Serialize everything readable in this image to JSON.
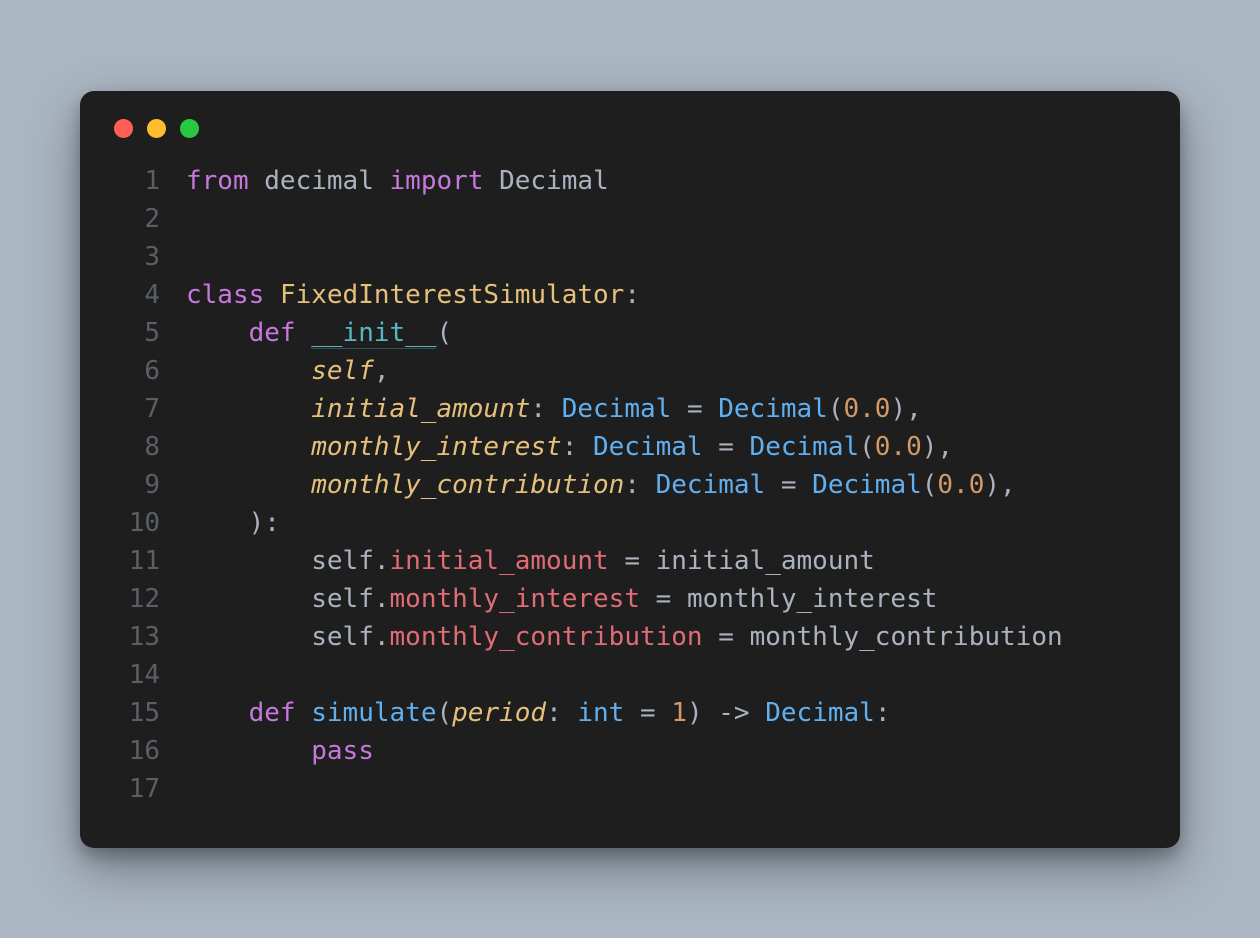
{
  "window": {
    "traffic_lights": [
      "red",
      "yellow",
      "green"
    ]
  },
  "code": {
    "lines": [
      {
        "n": "1",
        "tokens": [
          {
            "cls": "tok-keyword",
            "t": "from"
          },
          {
            "cls": "tok-punct",
            "t": " "
          },
          {
            "cls": "tok-module",
            "t": "decimal"
          },
          {
            "cls": "tok-punct",
            "t": " "
          },
          {
            "cls": "tok-keyword",
            "t": "import"
          },
          {
            "cls": "tok-punct",
            "t": " "
          },
          {
            "cls": "tok-module",
            "t": "Decimal"
          }
        ]
      },
      {
        "n": "2",
        "tokens": []
      },
      {
        "n": "3",
        "tokens": []
      },
      {
        "n": "4",
        "tokens": [
          {
            "cls": "tok-keyword",
            "t": "class"
          },
          {
            "cls": "tok-punct",
            "t": " "
          },
          {
            "cls": "tok-class",
            "t": "FixedInterestSimulator"
          },
          {
            "cls": "tok-punct",
            "t": ":"
          }
        ]
      },
      {
        "n": "5",
        "tokens": [
          {
            "cls": "tok-punct",
            "t": "    "
          },
          {
            "cls": "tok-keyword",
            "t": "def"
          },
          {
            "cls": "tok-punct",
            "t": " "
          },
          {
            "cls": "tok-dunder",
            "t": "__init__"
          },
          {
            "cls": "tok-punct",
            "t": "("
          }
        ]
      },
      {
        "n": "6",
        "tokens": [
          {
            "cls": "tok-punct",
            "t": "        "
          },
          {
            "cls": "tok-self",
            "t": "self"
          },
          {
            "cls": "tok-punct",
            "t": ","
          }
        ]
      },
      {
        "n": "7",
        "tokens": [
          {
            "cls": "tok-punct",
            "t": "        "
          },
          {
            "cls": "tok-param",
            "t": "initial_amount"
          },
          {
            "cls": "tok-punct",
            "t": ": "
          },
          {
            "cls": "tok-type",
            "t": "Decimal"
          },
          {
            "cls": "tok-punct",
            "t": " "
          },
          {
            "cls": "tok-op",
            "t": "="
          },
          {
            "cls": "tok-punct",
            "t": " "
          },
          {
            "cls": "tok-call",
            "t": "Decimal"
          },
          {
            "cls": "tok-punct",
            "t": "("
          },
          {
            "cls": "tok-num",
            "t": "0.0"
          },
          {
            "cls": "tok-punct",
            "t": "),"
          }
        ]
      },
      {
        "n": "8",
        "tokens": [
          {
            "cls": "tok-punct",
            "t": "        "
          },
          {
            "cls": "tok-param",
            "t": "monthly_interest"
          },
          {
            "cls": "tok-punct",
            "t": ": "
          },
          {
            "cls": "tok-type",
            "t": "Decimal"
          },
          {
            "cls": "tok-punct",
            "t": " "
          },
          {
            "cls": "tok-op",
            "t": "="
          },
          {
            "cls": "tok-punct",
            "t": " "
          },
          {
            "cls": "tok-call",
            "t": "Decimal"
          },
          {
            "cls": "tok-punct",
            "t": "("
          },
          {
            "cls": "tok-num",
            "t": "0.0"
          },
          {
            "cls": "tok-punct",
            "t": "),"
          }
        ]
      },
      {
        "n": "9",
        "tokens": [
          {
            "cls": "tok-punct",
            "t": "        "
          },
          {
            "cls": "tok-param",
            "t": "monthly_contribution"
          },
          {
            "cls": "tok-punct",
            "t": ": "
          },
          {
            "cls": "tok-type",
            "t": "Decimal"
          },
          {
            "cls": "tok-punct",
            "t": " "
          },
          {
            "cls": "tok-op",
            "t": "="
          },
          {
            "cls": "tok-punct",
            "t": " "
          },
          {
            "cls": "tok-call",
            "t": "Decimal"
          },
          {
            "cls": "tok-punct",
            "t": "("
          },
          {
            "cls": "tok-num",
            "t": "0.0"
          },
          {
            "cls": "tok-punct",
            "t": "),"
          }
        ]
      },
      {
        "n": "10",
        "tokens": [
          {
            "cls": "tok-punct",
            "t": "    ):"
          }
        ]
      },
      {
        "n": "11",
        "tokens": [
          {
            "cls": "tok-punct",
            "t": "        "
          },
          {
            "cls": "tok-ident",
            "t": "self"
          },
          {
            "cls": "tok-punct",
            "t": "."
          },
          {
            "cls": "tok-attr",
            "t": "initial_amount"
          },
          {
            "cls": "tok-punct",
            "t": " "
          },
          {
            "cls": "tok-op",
            "t": "="
          },
          {
            "cls": "tok-punct",
            "t": " "
          },
          {
            "cls": "tok-ident",
            "t": "initial_amount"
          }
        ]
      },
      {
        "n": "12",
        "tokens": [
          {
            "cls": "tok-punct",
            "t": "        "
          },
          {
            "cls": "tok-ident",
            "t": "self"
          },
          {
            "cls": "tok-punct",
            "t": "."
          },
          {
            "cls": "tok-attr",
            "t": "monthly_interest"
          },
          {
            "cls": "tok-punct",
            "t": " "
          },
          {
            "cls": "tok-op",
            "t": "="
          },
          {
            "cls": "tok-punct",
            "t": " "
          },
          {
            "cls": "tok-ident",
            "t": "monthly_interest"
          }
        ]
      },
      {
        "n": "13",
        "tokens": [
          {
            "cls": "tok-punct",
            "t": "        "
          },
          {
            "cls": "tok-ident",
            "t": "self"
          },
          {
            "cls": "tok-punct",
            "t": "."
          },
          {
            "cls": "tok-attr",
            "t": "monthly_contribution"
          },
          {
            "cls": "tok-punct",
            "t": " "
          },
          {
            "cls": "tok-op",
            "t": "="
          },
          {
            "cls": "tok-punct",
            "t": " "
          },
          {
            "cls": "tok-ident",
            "t": "monthly_contribution"
          }
        ]
      },
      {
        "n": "14",
        "tokens": []
      },
      {
        "n": "15",
        "tokens": [
          {
            "cls": "tok-punct",
            "t": "    "
          },
          {
            "cls": "tok-keyword",
            "t": "def"
          },
          {
            "cls": "tok-punct",
            "t": " "
          },
          {
            "cls": "tok-func",
            "t": "simulate"
          },
          {
            "cls": "tok-punct",
            "t": "("
          },
          {
            "cls": "tok-param",
            "t": "period"
          },
          {
            "cls": "tok-punct",
            "t": ": "
          },
          {
            "cls": "tok-type",
            "t": "int"
          },
          {
            "cls": "tok-punct",
            "t": " "
          },
          {
            "cls": "tok-op",
            "t": "="
          },
          {
            "cls": "tok-punct",
            "t": " "
          },
          {
            "cls": "tok-num",
            "t": "1"
          },
          {
            "cls": "tok-punct",
            "t": ") "
          },
          {
            "cls": "tok-arrow",
            "t": "->"
          },
          {
            "cls": "tok-punct",
            "t": " "
          },
          {
            "cls": "tok-type",
            "t": "Decimal"
          },
          {
            "cls": "tok-punct",
            "t": ":"
          }
        ]
      },
      {
        "n": "16",
        "tokens": [
          {
            "cls": "tok-punct",
            "t": "        "
          },
          {
            "cls": "tok-keyword",
            "t": "pass"
          }
        ]
      },
      {
        "n": "17",
        "tokens": []
      }
    ]
  }
}
